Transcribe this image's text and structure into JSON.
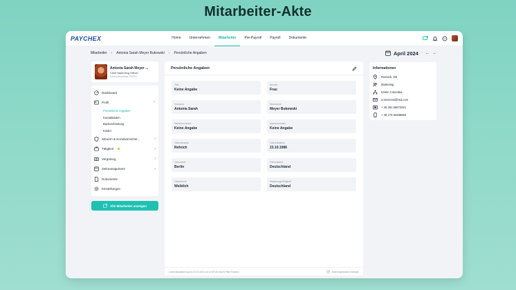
{
  "page_heading": "Mitarbeiter-Akte",
  "app": {
    "logo": "PAYCHEX",
    "nav": [
      {
        "label": "Home"
      },
      {
        "label": "Unternehmen"
      },
      {
        "label": "Mitarbeiter",
        "active": true
      },
      {
        "label": "Pre-Payroll"
      },
      {
        "label": "Payroll"
      },
      {
        "label": "Dokumente"
      }
    ],
    "top_icons": [
      "chat-icon",
      "bell-icon",
      "help-icon",
      "user-avatar"
    ]
  },
  "breadcrumb": [
    "Mitarbeiter",
    "Antonia Sarah Meyer Bukowski",
    "Persönliche Angaben"
  ],
  "date": {
    "label": "April 2024",
    "icon": "calendar-icon"
  },
  "profile": {
    "name": "Antonia Sarah Meyer ...",
    "role": "Chief Marketing Officer",
    "id": "Personalnummer 000012"
  },
  "sidenav": {
    "items": [
      {
        "label": "Dashboard",
        "icon": "dashboard-icon"
      },
      {
        "label": "Profil",
        "icon": "profile-icon",
        "expanded": true,
        "children": [
          {
            "label": "Persönliche Angaben",
            "active": true
          },
          {
            "label": "Kontaktdaten"
          },
          {
            "label": "Bankverbindung"
          },
          {
            "label": "Kinder"
          }
        ]
      },
      {
        "label": "Steuern & Sozialversicher...",
        "icon": "shield-icon"
      },
      {
        "label": "Tätigkeit",
        "icon": "briefcase-icon",
        "warning": true
      },
      {
        "label": "Vergütung",
        "icon": "money-icon"
      },
      {
        "label": "Zeitmanagement",
        "icon": "clock-icon"
      },
      {
        "label": "Dokumente",
        "icon": "document-icon"
      },
      {
        "label": "Einstellungen",
        "icon": "gear-icon"
      }
    ]
  },
  "cta": {
    "label": "Alle Mitarbeiter anzeigen",
    "icon": "external-link-icon"
  },
  "main": {
    "title": "Persönliche Angaben",
    "fields": [
      {
        "label": "Titel",
        "value": "Keine Angabe"
      },
      {
        "label": "Anrede",
        "value": "Frau"
      },
      {
        "label": "Vorname",
        "value": "Antonia Sarah"
      },
      {
        "label": "Nachname",
        "value": "Meyer Bukowski"
      },
      {
        "label": "Namensvorsatz",
        "value": "Keine Angabe"
      },
      {
        "label": "Namenszusatz",
        "value": "Keine Angabe"
      },
      {
        "label": "Geburtsname",
        "value": "Rehrich"
      },
      {
        "label": "Geburtsdatum",
        "value": "23.10.1986"
      },
      {
        "label": "Geburtsort",
        "value": "Berlin"
      },
      {
        "label": "Geburtsland",
        "value": "Deutschland"
      },
      {
        "label": "Geschlecht",
        "value": "Weiblich"
      },
      {
        "label": "Staatsangehörigkeit",
        "value": "Deutschland"
      }
    ],
    "footer_left": "Letzte Aktualisierung am 22.03.2021 um 14:59 Uhr durch Peter Paulsen",
    "footer_right": "Änderungshistorie anzeigen"
  },
  "info": {
    "title": "Informationen",
    "rows": [
      {
        "icon": "location-icon",
        "text": "Rostock, DE"
      },
      {
        "icon": "team-icon",
        "text": "Marketing"
      },
      {
        "icon": "hierarchy-icon",
        "text": "Kristin Columbia"
      },
      {
        "icon": "mail-icon",
        "text": "a.siemens@hsd.com"
      },
      {
        "icon": "phone-icon",
        "text": "+ 49 381 65672921"
      },
      {
        "icon": "mobile-icon",
        "text": "+ 49 176 93486883"
      }
    ]
  },
  "colors": {
    "accent": "#1fc2b1",
    "brand": "#1d4fa8",
    "background": "#8fd9c9"
  }
}
